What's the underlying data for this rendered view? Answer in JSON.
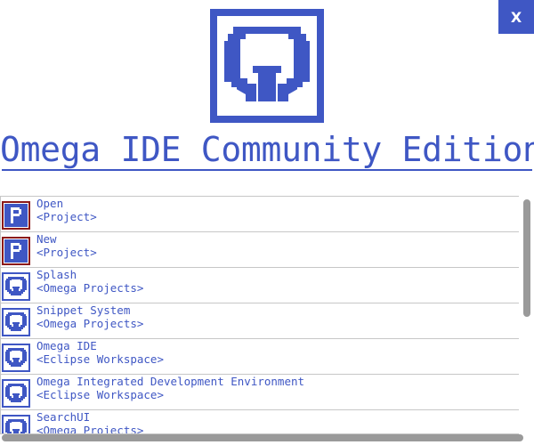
{
  "window": {
    "close_label": "X",
    "title": "Omega IDE Community Edition"
  },
  "colors": {
    "accent": "#3f57c4",
    "project_icon_border": "#8b1a1a",
    "separator": "#c7c7c7",
    "scrollbar": "#9a9a9a"
  },
  "projects": [
    {
      "name": "Open",
      "sub": "<Project>",
      "icon": "project-p-icon"
    },
    {
      "name": "New",
      "sub": "<Project>",
      "icon": "project-p-icon"
    },
    {
      "name": "Splash",
      "sub": "<Omega Projects>",
      "icon": "omega-icon"
    },
    {
      "name": "Snippet System",
      "sub": "<Omega Projects>",
      "icon": "omega-icon"
    },
    {
      "name": "Omega IDE",
      "sub": "<Eclipse Workspace>",
      "icon": "omega-icon"
    },
    {
      "name": "Omega Integrated Development Environment",
      "sub": "<Eclipse Workspace>",
      "icon": "omega-icon"
    },
    {
      "name": "SearchUI",
      "sub": "<Omega Projects>",
      "icon": "omega-icon"
    }
  ]
}
